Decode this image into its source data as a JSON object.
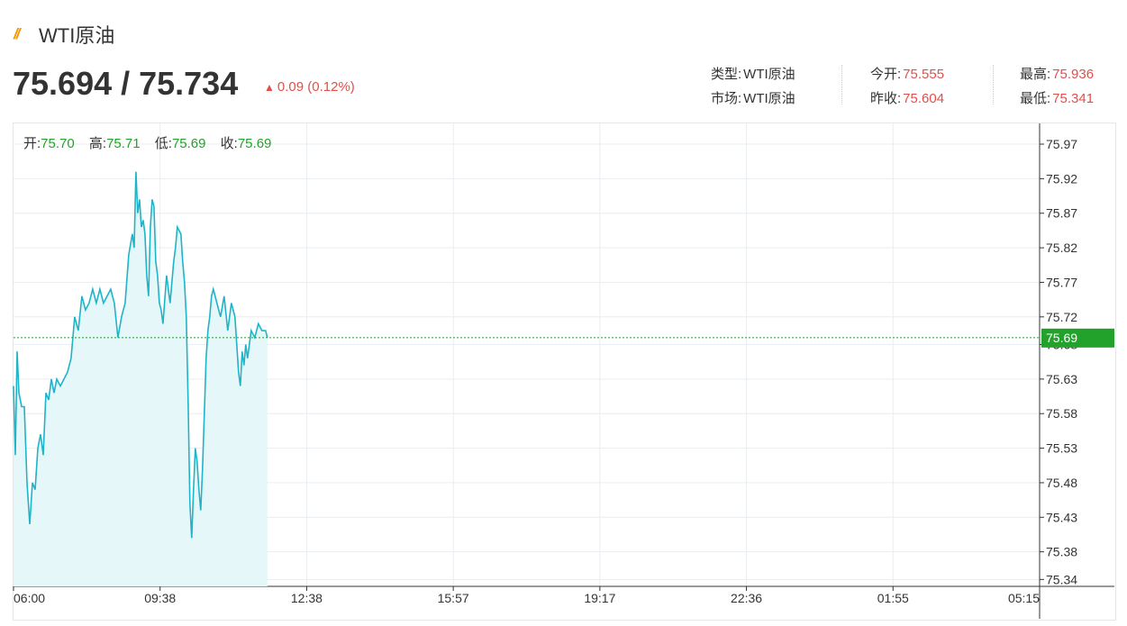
{
  "header": {
    "title": "WTI原油",
    "price": "75.694 / 75.734",
    "change": "0.09 (0.12%)"
  },
  "stats": {
    "type_label": "类型:",
    "type_value": "WTI原油",
    "market_label": "市场:",
    "market_value": "WTI原油",
    "open_label": "今开:",
    "open_value": "75.555",
    "prev_close_label": "昨收:",
    "prev_close_value": "75.604",
    "high_label": "最高:",
    "high_value": "75.936",
    "low_label": "最低:",
    "low_value": "75.341"
  },
  "ohlc": {
    "open_label": "开:",
    "open_value": "75.70",
    "high_label": "高:",
    "high_value": "75.71",
    "low_label": "低:",
    "low_value": "75.69",
    "close_label": "收:",
    "close_value": "75.69"
  },
  "colors": {
    "line": "#1fb4c8",
    "fill": "#e6f7f9",
    "up": "#e0504b",
    "green": "#22a22a",
    "grid": "#e9eef2"
  },
  "chart_data": {
    "type": "area",
    "title": "",
    "xlabel": "",
    "ylabel": "",
    "x_ticks": [
      "06:00",
      "09:38",
      "12:38",
      "15:57",
      "19:17",
      "22:36",
      "01:55",
      "05:15"
    ],
    "y_ticks": [
      "75.97",
      "75.92",
      "75.87",
      "75.82",
      "75.77",
      "75.72",
      "75.68",
      "75.63",
      "75.58",
      "75.53",
      "75.48",
      "75.43",
      "75.38",
      "75.34"
    ],
    "ylim": [
      75.33,
      76.0
    ],
    "grid": true,
    "current_price": 75.69,
    "current_price_label": "75.69",
    "x_index_range": [
      0,
      1140
    ],
    "series": [
      {
        "x": [
          0,
          2,
          4,
          6,
          9,
          12,
          15,
          18,
          21,
          24,
          27,
          30,
          33,
          36,
          39,
          42,
          45,
          48,
          52,
          56,
          60,
          64,
          68,
          72,
          76,
          80,
          84,
          88,
          92,
          96,
          100,
          104,
          108,
          112,
          116,
          120,
          122,
          124,
          128,
          132,
          134,
          136,
          138,
          140,
          142,
          144,
          146,
          148,
          150,
          152,
          154,
          156,
          158,
          160,
          162,
          164,
          166,
          170,
          174,
          178,
          180,
          182,
          186,
          188,
          190,
          192,
          194,
          196,
          198,
          200,
          202,
          204,
          206,
          208,
          210,
          212,
          214,
          216,
          218,
          220,
          222,
          226,
          230,
          234,
          238,
          242,
          246,
          248,
          250,
          252,
          254,
          256,
          258,
          260,
          264,
          268,
          272,
          276,
          280,
          282
        ],
        "values": [
          75.62,
          75.52,
          75.67,
          75.61,
          75.59,
          75.59,
          75.48,
          75.42,
          75.48,
          75.47,
          75.53,
          75.55,
          75.52,
          75.61,
          75.6,
          75.63,
          75.61,
          75.63,
          75.62,
          75.63,
          75.64,
          75.66,
          75.72,
          75.7,
          75.75,
          75.73,
          75.74,
          75.76,
          75.74,
          75.76,
          75.74,
          75.75,
          75.76,
          75.74,
          75.69,
          75.72,
          75.73,
          75.74,
          75.81,
          75.84,
          75.82,
          75.93,
          75.87,
          75.89,
          75.85,
          75.86,
          75.84,
          75.78,
          75.75,
          75.85,
          75.89,
          75.88,
          75.8,
          75.78,
          75.74,
          75.73,
          75.71,
          75.78,
          75.74,
          75.8,
          75.82,
          75.85,
          75.84,
          75.8,
          75.77,
          75.72,
          75.6,
          75.45,
          75.4,
          75.47,
          75.53,
          75.51,
          75.47,
          75.44,
          75.5,
          75.58,
          75.66,
          75.7,
          75.72,
          75.75,
          75.76,
          75.74,
          75.72,
          75.75,
          75.7,
          75.74,
          75.72,
          75.68,
          75.64,
          75.62,
          75.67,
          75.65,
          75.68,
          75.66,
          75.7,
          75.69,
          75.71,
          75.7,
          75.7,
          75.69
        ]
      }
    ]
  }
}
